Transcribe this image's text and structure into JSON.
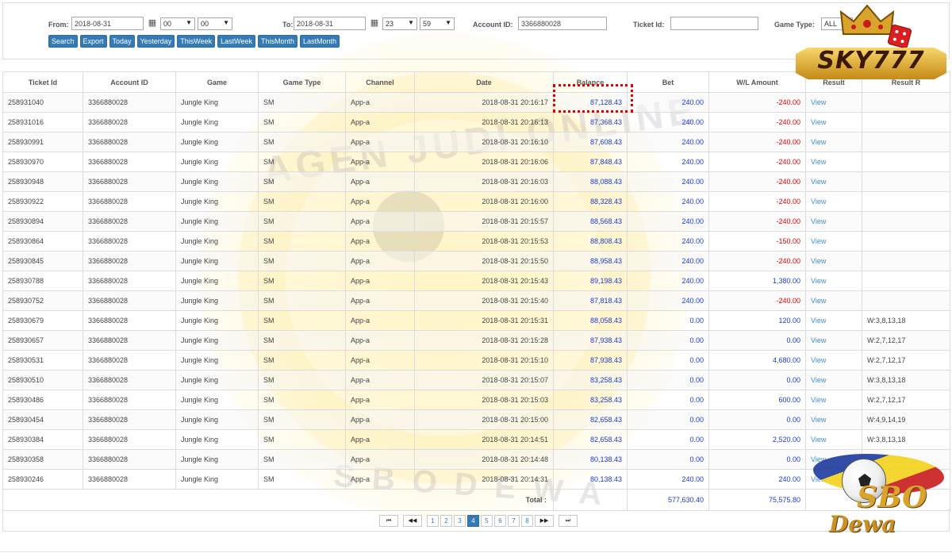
{
  "filters": {
    "from_label": "From:",
    "from_date": "2018-08-31",
    "from_hour": "00",
    "from_min": "00",
    "to_label": "To:",
    "to_date": "2018-08-31",
    "to_hour": "23",
    "to_min": "59",
    "account_label": "Account ID:",
    "account_value": "3366880028",
    "ticket_label": "Ticket Id:",
    "ticket_value": "",
    "gametype_label": "Game Type:",
    "gametype_value": "ALL"
  },
  "buttons": {
    "search": "Search",
    "export": "Export",
    "today": "Today",
    "yesterday": "Yesterday",
    "thisweek": "ThisWeek",
    "lastweek": "LastWeek",
    "thismonth": "ThisMonth",
    "lastmonth": "LastMonth"
  },
  "table": {
    "headers": [
      "Ticket Id",
      "Account ID",
      "Game",
      "Game Type",
      "Channel",
      "Date",
      "Balance",
      "Bet",
      "W/L Amount",
      "Result",
      "Result R"
    ],
    "rows": [
      [
        "258931040",
        "3366880028",
        "Jungle King",
        "SM",
        "App-a",
        "2018-08-31 20:16:17",
        "87,128.43",
        "240.00",
        "-240.00",
        "View",
        ""
      ],
      [
        "258931016",
        "3366880028",
        "Jungle King",
        "SM",
        "App-a",
        "2018-08-31 20:16:13",
        "87,368.43",
        "240.00",
        "-240.00",
        "View",
        ""
      ],
      [
        "258930991",
        "3366880028",
        "Jungle King",
        "SM",
        "App-a",
        "2018-08-31 20:16:10",
        "87,608.43",
        "240.00",
        "-240.00",
        "View",
        ""
      ],
      [
        "258930970",
        "3366880028",
        "Jungle King",
        "SM",
        "App-a",
        "2018-08-31 20:16:06",
        "87,848.43",
        "240.00",
        "-240.00",
        "View",
        ""
      ],
      [
        "258930948",
        "3366880028",
        "Jungle King",
        "SM",
        "App-a",
        "2018-08-31 20:16:03",
        "88,088.43",
        "240.00",
        "-240.00",
        "View",
        ""
      ],
      [
        "258930922",
        "3366880028",
        "Jungle King",
        "SM",
        "App-a",
        "2018-08-31 20:16:00",
        "88,328.43",
        "240.00",
        "-240.00",
        "View",
        ""
      ],
      [
        "258930894",
        "3366880028",
        "Jungle King",
        "SM",
        "App-a",
        "2018-08-31 20:15:57",
        "88,568.43",
        "240.00",
        "-240.00",
        "View",
        ""
      ],
      [
        "258930864",
        "3366880028",
        "Jungle King",
        "SM",
        "App-a",
        "2018-08-31 20:15:53",
        "88,808.43",
        "240.00",
        "-150.00",
        "View",
        ""
      ],
      [
        "258930845",
        "3366880028",
        "Jungle King",
        "SM",
        "App-a",
        "2018-08-31 20:15:50",
        "88,958.43",
        "240.00",
        "-240.00",
        "View",
        ""
      ],
      [
        "258930788",
        "3366880028",
        "Jungle King",
        "SM",
        "App-a",
        "2018-08-31 20:15:43",
        "89,198.43",
        "240.00",
        "1,380.00",
        "View",
        ""
      ],
      [
        "258930752",
        "3366880028",
        "Jungle King",
        "SM",
        "App-a",
        "2018-08-31 20:15:40",
        "87,818.43",
        "240.00",
        "-240.00",
        "View",
        ""
      ],
      [
        "258930679",
        "3366880028",
        "Jungle King",
        "SM",
        "App-a",
        "2018-08-31 20:15:31",
        "88,058.43",
        "0.00",
        "120.00",
        "View",
        "W:3,8,13,18"
      ],
      [
        "258930657",
        "3366880028",
        "Jungle King",
        "SM",
        "App-a",
        "2018-08-31 20:15:28",
        "87,938.43",
        "0.00",
        "0.00",
        "View",
        "W:2,7,12,17"
      ],
      [
        "258930531",
        "3366880028",
        "Jungle King",
        "SM",
        "App-a",
        "2018-08-31 20:15:10",
        "87,938.43",
        "0.00",
        "4,680.00",
        "View",
        "W:2,7,12,17"
      ],
      [
        "258930510",
        "3366880028",
        "Jungle King",
        "SM",
        "App-a",
        "2018-08-31 20:15:07",
        "83,258.43",
        "0.00",
        "0.00",
        "View",
        "W:3,8,13,18"
      ],
      [
        "258930486",
        "3366880028",
        "Jungle King",
        "SM",
        "App-a",
        "2018-08-31 20:15:03",
        "83,258.43",
        "0.00",
        "600.00",
        "View",
        "W:2,7,12,17"
      ],
      [
        "258930454",
        "3366880028",
        "Jungle King",
        "SM",
        "App-a",
        "2018-08-31 20:15:00",
        "82,658.43",
        "0.00",
        "0.00",
        "View",
        "W:4,9,14,19"
      ],
      [
        "258930384",
        "3366880028",
        "Jungle King",
        "SM",
        "App-a",
        "2018-08-31 20:14:51",
        "82,658.43",
        "0.00",
        "2,520.00",
        "View",
        "W:3,8,13,18"
      ],
      [
        "258930358",
        "3366880028",
        "Jungle King",
        "SM",
        "App-a",
        "2018-08-31 20:14:48",
        "80,138.43",
        "0.00",
        "0.00",
        "View",
        ""
      ],
      [
        "258930246",
        "3366880028",
        "Jungle King",
        "SM",
        "App-a",
        "2018-08-31 20:14:31",
        "80,138.43",
        "240.00",
        "240.00",
        "View",
        ""
      ]
    ],
    "total_label": "Total :",
    "total_bet": "577,630.40",
    "total_wl": "75,575.80"
  },
  "pager": {
    "first": "⏮",
    "prev": "◀◀",
    "pages": [
      "1",
      "2",
      "3",
      "4",
      "5",
      "6",
      "7",
      "8"
    ],
    "active_page": "4",
    "next": "▶▶",
    "last": "⏭"
  },
  "watermark": {
    "top_text": "AGEN JUDI ONLINE",
    "bottom_text": "SBODEWA"
  },
  "logos": {
    "sky": "SKY777",
    "sbo_main": "SBO",
    "sbo_sub": "Dewa"
  },
  "colors": {
    "button_blue": "#337ab7",
    "negative_red": "#e00000",
    "positive_blue": "#1a3bd8",
    "view_link": "#3f8fd2",
    "highlight_red": "#e00000"
  },
  "icons": {
    "calendar": "calendar-icon",
    "dropdown": "chevron-down-icon"
  }
}
